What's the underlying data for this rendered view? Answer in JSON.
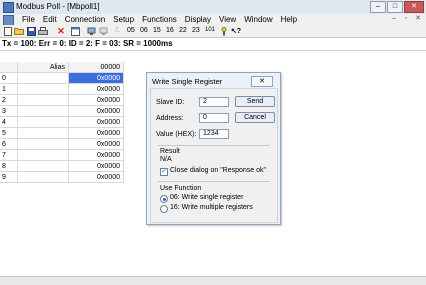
{
  "window": {
    "title": "Modbus Poll - [Mbpoll1]",
    "controls": [
      "‒",
      "□",
      "✕"
    ]
  },
  "menu": [
    "File",
    "Edit",
    "Connection",
    "Setup",
    "Functions",
    "Display",
    "View",
    "Window",
    "Help"
  ],
  "mdi_controls": [
    "–",
    "▫",
    "✕"
  ],
  "toolbar": {
    "function_codes": [
      "05",
      "06",
      "15",
      "16",
      "22",
      "23"
    ],
    "extra_label": "101"
  },
  "status_line": "Tx = 100: Err = 0: ID = 2: F = 03: SR = 1000ms",
  "grid": {
    "header_alias": "Alias",
    "header_value": "00000",
    "rows": [
      {
        "index": "0",
        "value": "0x0000"
      },
      {
        "index": "1",
        "value": "0x0000"
      },
      {
        "index": "2",
        "value": "0x0000"
      },
      {
        "index": "3",
        "value": "0x0000"
      },
      {
        "index": "4",
        "value": "0x0000"
      },
      {
        "index": "5",
        "value": "0x0000"
      },
      {
        "index": "6",
        "value": "0x0000"
      },
      {
        "index": "7",
        "value": "0x0000"
      },
      {
        "index": "8",
        "value": "0x0000"
      },
      {
        "index": "9",
        "value": "0x0000"
      }
    ]
  },
  "dialog": {
    "title": "Write Single Register",
    "close_label": "✕",
    "slave_id_label": "Slave ID:",
    "slave_id_value": "2",
    "address_label": "Address:",
    "address_value": "0",
    "value_label": "Value (HEX):",
    "value_value": "1234",
    "send_label": "Send",
    "cancel_label": "Cancel",
    "result_heading": "Result",
    "result_text": "N/A",
    "close_checkbox_label": "Close dialog on \"Response ok\"",
    "close_checkbox_checked": true,
    "use_function_heading": "Use Function",
    "option_06_label": "06: Write single register",
    "option_16_label": "16: Write multiple registers",
    "selected_option": "06"
  }
}
